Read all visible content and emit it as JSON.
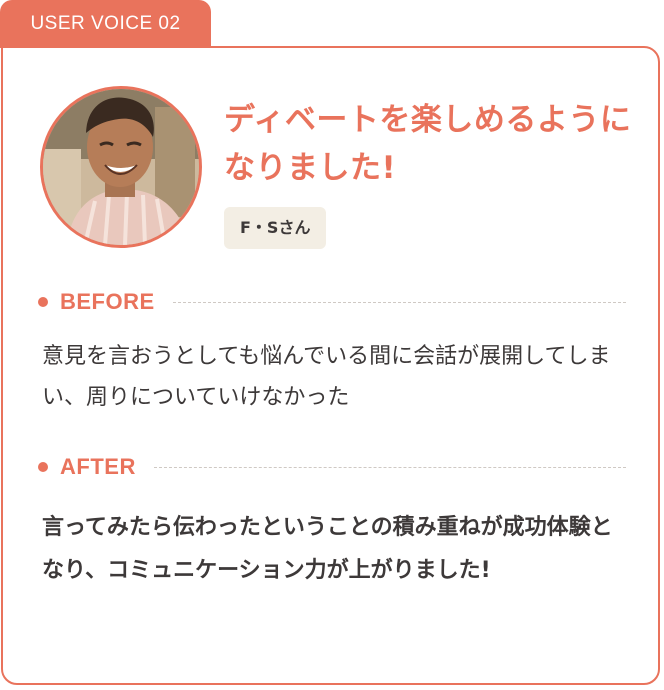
{
  "tab": {
    "label": "USER VOICE 02"
  },
  "avatar": {
    "icon": "person-photo",
    "alt": "F・Sさん"
  },
  "headline": "ディベートを楽しめるようになりました!",
  "name_badge": "F・Sさん",
  "before": {
    "label": "BEFORE",
    "text": "意見を言おうとしても悩んでいる間に会話が展開してしまい、周りについていけなかった"
  },
  "after": {
    "label": "AFTER",
    "text": "言ってみたら伝わったということの積み重ねが成功体験となり、コミュニケーション力が上がりました!"
  },
  "colors": {
    "accent": "#e9735c",
    "badge_bg": "#f3eee4",
    "text": "#3d3939"
  }
}
